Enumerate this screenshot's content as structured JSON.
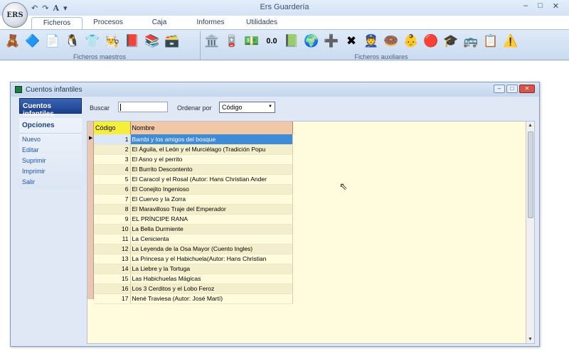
{
  "app": {
    "logo_text": "ERS",
    "title": "Ers Guardería",
    "qat": [
      "↶",
      "↷",
      "A",
      "▾"
    ],
    "window_controls": [
      "–",
      "□",
      "✕"
    ]
  },
  "ribbon": {
    "tabs": [
      "Ficheros",
      "Procesos",
      "Caja",
      "Informes",
      "Utilidades"
    ],
    "groups": [
      {
        "label": "Ficheros maestros",
        "icons": [
          "🧸",
          "🔷",
          "📄",
          "🐧",
          "👕",
          "👨‍🍳",
          "📕",
          "📚",
          "🗃️"
        ]
      },
      {
        "label": "Ficheros auxiliares",
        "icons": [
          "🏛️",
          "🪫",
          "💵",
          "0.0",
          "📗",
          "🌍",
          "➕",
          "✖",
          "👮",
          "🍩",
          "👶",
          "🔴",
          "🎓",
          "🚌",
          "📋",
          "⚠️"
        ]
      }
    ]
  },
  "window": {
    "title": "Cuentos infantiles",
    "controls": [
      "–",
      "□",
      "✕"
    ]
  },
  "sidebar": {
    "header": "Cuentos infantiles",
    "options_title": "Opciones",
    "options": [
      "Nuevo",
      "Editar",
      "Suprimir",
      "Imprimir",
      "Salir"
    ]
  },
  "search": {
    "label": "Buscar",
    "value": "",
    "order_label": "Ordenar por",
    "order_value": "Código"
  },
  "table": {
    "columns": [
      "Código",
      "Nombre"
    ],
    "rows": [
      [
        "1",
        "Bambi y los amigos del bosque"
      ],
      [
        "2",
        "El Águila, el León y el Murciélago (Tradición Popu"
      ],
      [
        "3",
        "El Asno y el perrito"
      ],
      [
        "4",
        "El Burrito Descontento"
      ],
      [
        "5",
        "El Caracol y el Rosal (Autor: Hans Christian Ander"
      ],
      [
        "6",
        "El Conejito Ingenioso"
      ],
      [
        "7",
        "El Cuervo y la Zorra"
      ],
      [
        "8",
        "El Maravilloso Traje del Emperador"
      ],
      [
        "9",
        "EL PRÍNCIPE RANA"
      ],
      [
        "10",
        "La Bella Durmiente"
      ],
      [
        "11",
        "La Cenicienta"
      ],
      [
        "12",
        "La Leyenda de la Osa Mayor (Cuento Ingles)"
      ],
      [
        "13",
        "La Princesa y el Habichuela(Autor: Hans Christian"
      ],
      [
        "14",
        "La Liebre y la Tortuga"
      ],
      [
        "15",
        "Las Habichuelas Mágicas"
      ],
      [
        "16",
        "Los 3 Cerditos y el Lobo Feroz"
      ],
      [
        "17",
        "Nené Traviesa (Autor: José Martí)"
      ]
    ],
    "selected_row": 0
  },
  "colors": {
    "selection": "#3f8bd8",
    "grid_bg": "#fffbdc",
    "code_header": "#f6ef3a",
    "name_header": "#f0c8a7"
  }
}
